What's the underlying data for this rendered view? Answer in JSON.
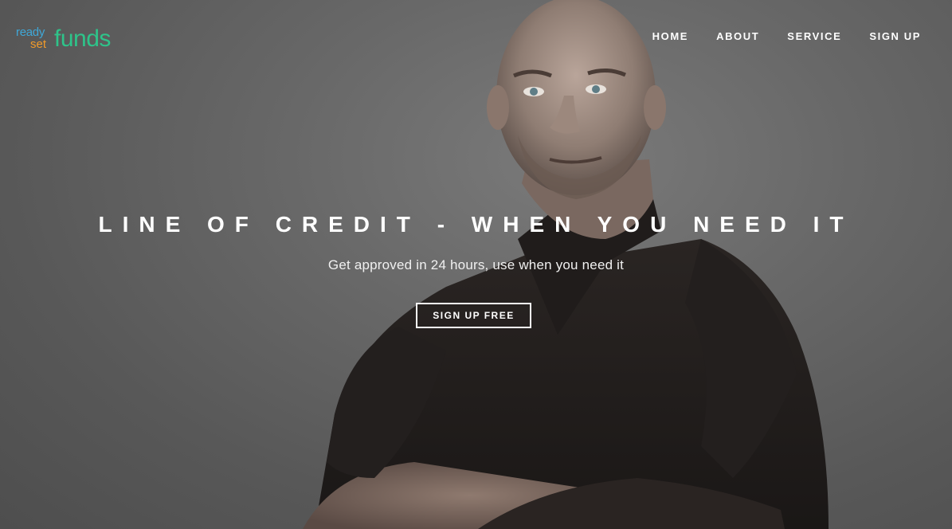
{
  "brand": {
    "logo_ready": "ready",
    "logo_set": "set",
    "logo_funds": "funds",
    "colors": {
      "ready": "#3fa8d8",
      "set": "#f09a2a",
      "funds": "#2ec48a"
    }
  },
  "nav": {
    "items": [
      {
        "label": "HOME"
      },
      {
        "label": "ABOUT"
      },
      {
        "label": "SERVICE"
      },
      {
        "label": "SIGN UP"
      }
    ]
  },
  "hero": {
    "headline": "LINE OF CREDIT - WHEN YOU NEED IT",
    "subheadline": "Get approved in 24 hours, use when you need it",
    "cta_label": "SIGN UP FREE",
    "background_image": "man-with-crossed-arms-photo"
  }
}
